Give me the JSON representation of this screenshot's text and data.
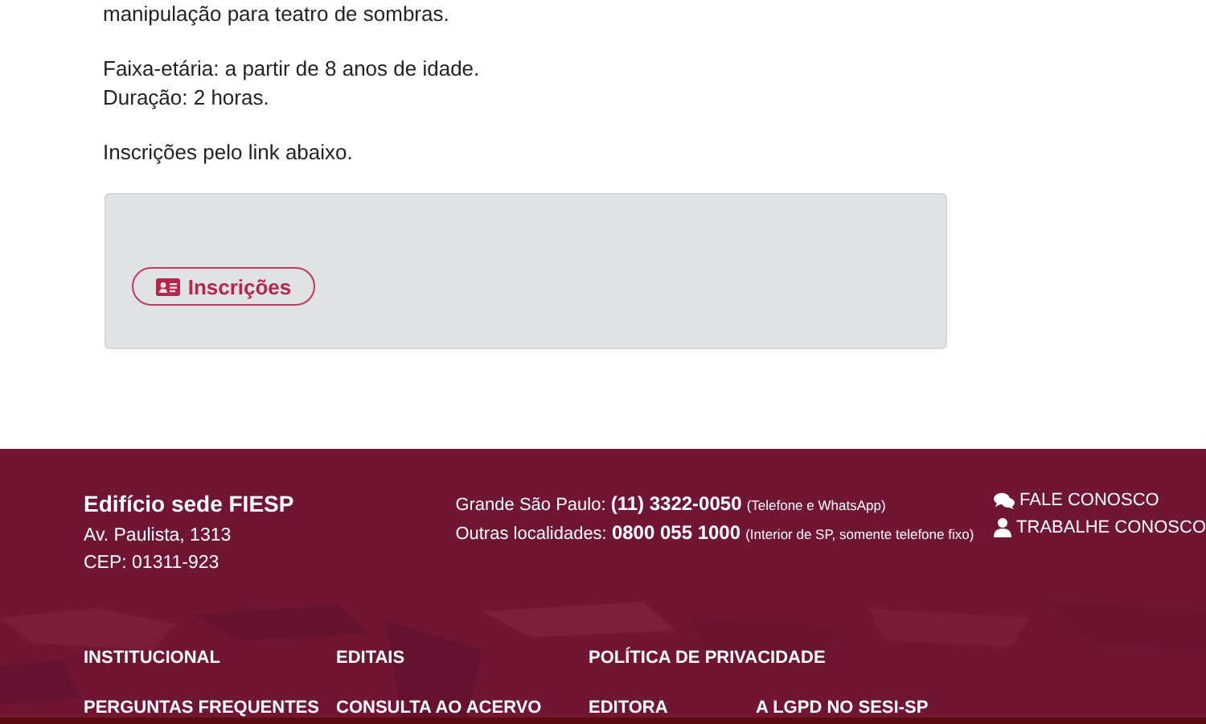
{
  "article": {
    "paragraphs": [
      [
        "manipulação para teatro de sombras."
      ],
      [
        "Faixa-etária: a partir de 8 anos de idade.",
        "Duração: 2 horas."
      ],
      [
        "Inscrições pelo link abaixo."
      ]
    ]
  },
  "registration_box": {
    "button": "Inscrições"
  },
  "footer": {
    "building": {
      "title": "Edifício sede FIESP",
      "lines": [
        "Av. Paulista, 1313",
        "CEP: 01311-923"
      ]
    },
    "phones": [
      {
        "label": "Grande São Paulo:",
        "number": "(11) 3322-0050",
        "note": "(Telefone e WhatsApp)"
      },
      {
        "label": "Outras localidades:",
        "number": "0800 055 1000",
        "note": "(Interior de SP, somente telefone fixo)"
      }
    ],
    "contact_links": [
      {
        "kind": "chat",
        "label": "FALE CONOSCO"
      },
      {
        "kind": "person",
        "label": "TRABALHE CONOSCO"
      }
    ],
    "nav_rows": [
      [
        "INSTITUCIONAL",
        "EDITAIS",
        "POLÍTICA DE PRIVACIDADE"
      ],
      [
        "PERGUNTAS FREQUENTES",
        "CONSULTA AO ACERVO",
        "EDITORA",
        "A LGPD NO SESI-SP"
      ]
    ]
  }
}
